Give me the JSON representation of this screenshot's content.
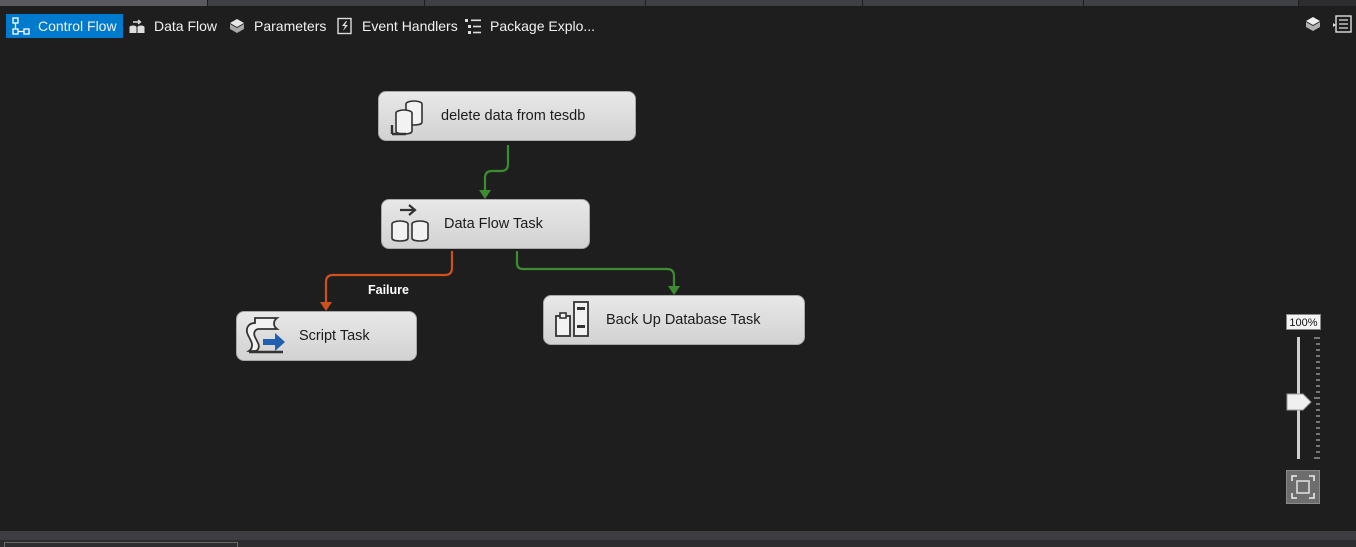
{
  "tabs": [
    {
      "label": "Control Flow",
      "icon": "control-flow-icon",
      "active": true
    },
    {
      "label": "Data Flow",
      "icon": "data-flow-icon",
      "active": false
    },
    {
      "label": "Parameters",
      "icon": "parameters-icon",
      "active": false
    },
    {
      "label": "Event Handlers",
      "icon": "event-handlers-icon",
      "active": false
    },
    {
      "label": "Package Explo...",
      "icon": "package-explorer-icon",
      "active": false
    }
  ],
  "toolbar_right": [
    {
      "icon": "variables-icon"
    },
    {
      "icon": "column-list-icon"
    }
  ],
  "tasks": {
    "delete": {
      "label": "delete data from tesdb",
      "icon": "execute-sql-task-icon"
    },
    "dataflow": {
      "label": "Data Flow Task",
      "icon": "data-flow-task-icon"
    },
    "script": {
      "label": "Script Task",
      "icon": "script-task-icon"
    },
    "backup": {
      "label": "Back Up Database Task",
      "icon": "backup-database-task-icon"
    }
  },
  "constraints": {
    "failure_label": "Failure",
    "success_color": "#3c8d2f",
    "failure_color": "#d0501c"
  },
  "zoom": {
    "label": "100%",
    "percent": 100
  },
  "colors": {
    "canvas": "#1e1e1e",
    "active_tab": "#007acc",
    "task_fill": "#dcdcdc"
  }
}
